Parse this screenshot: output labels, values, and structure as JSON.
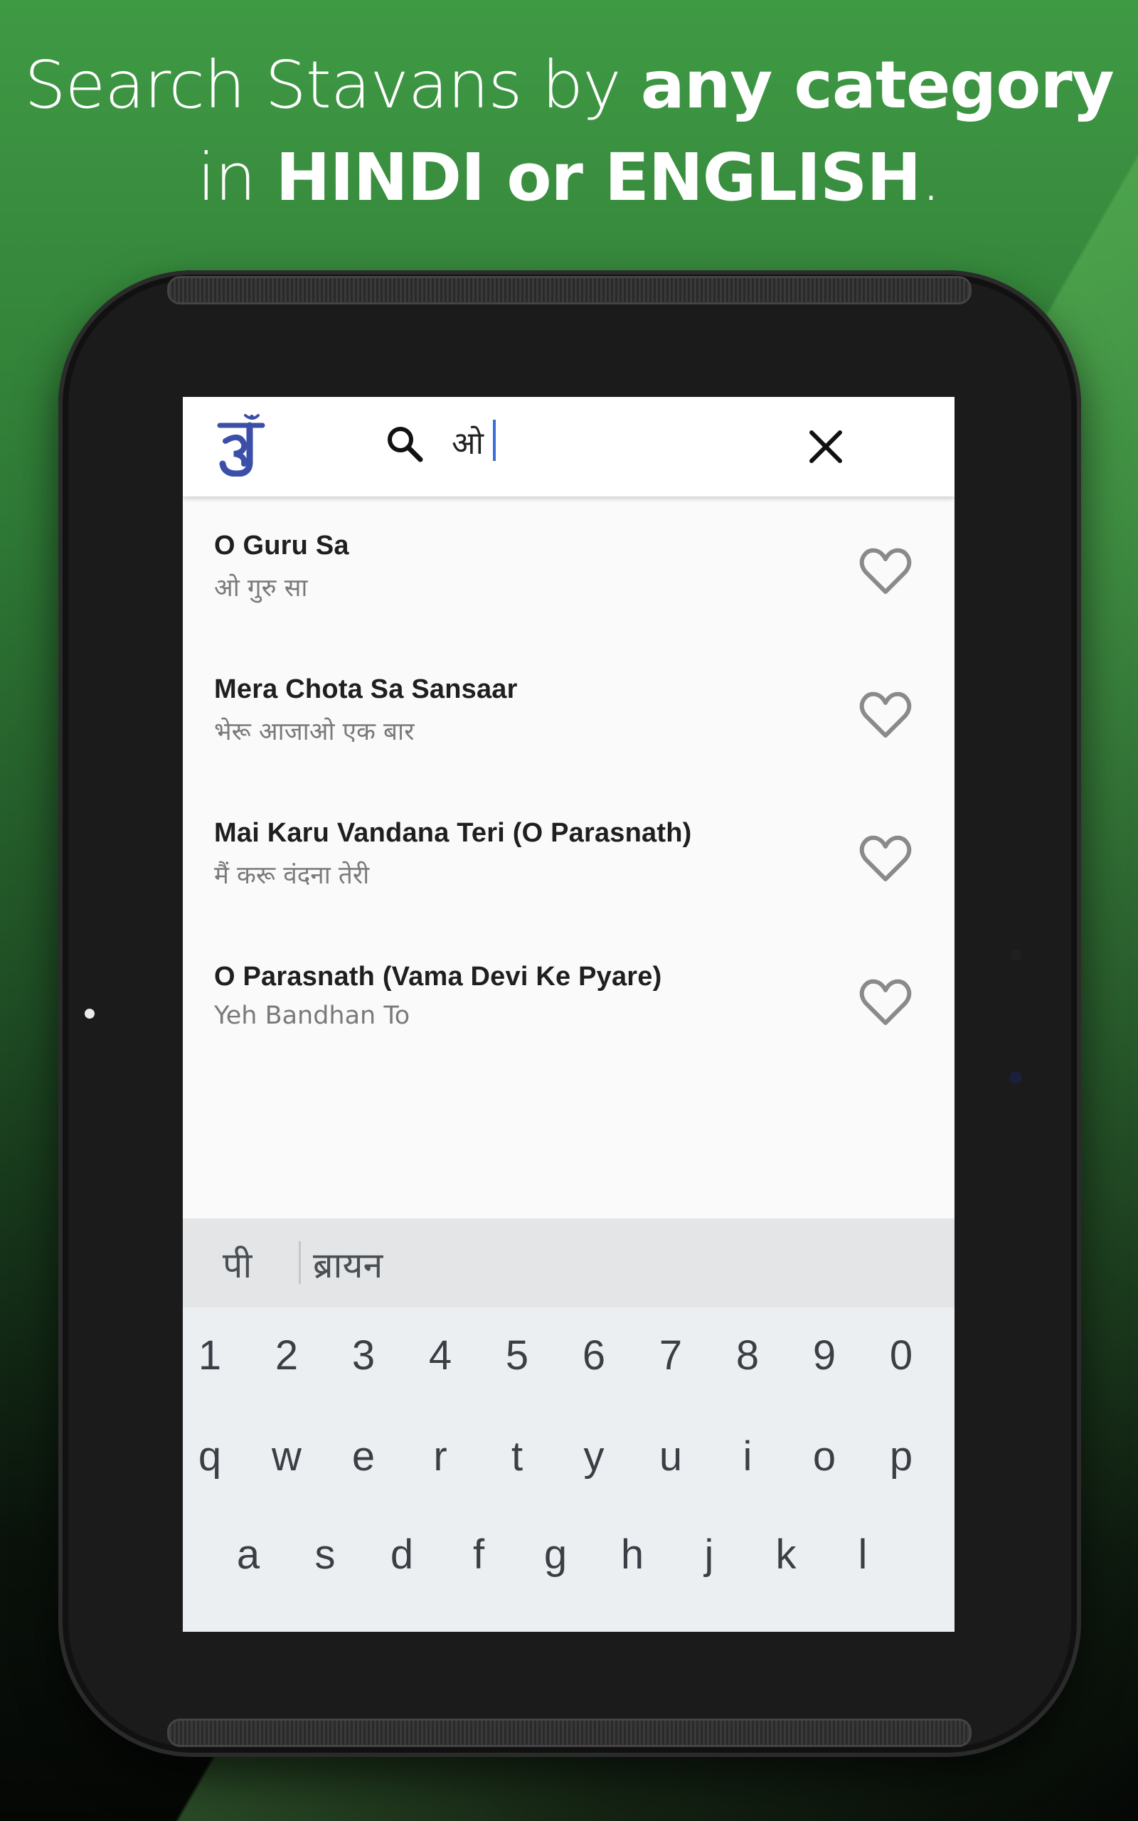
{
  "headline": {
    "line1_light": "Search Stavans by ",
    "line1_bold": "any category",
    "line2_light": "in ",
    "line2_bold1": "HINDI",
    "line2_light2": " or ",
    "line2_bold2": "ENGLISH",
    "line2_end": "."
  },
  "search": {
    "query": "ओ",
    "accent": "#3b6fd8"
  },
  "results": [
    {
      "title": "O Guru Sa",
      "subtitle": "ओ गुरु सा"
    },
    {
      "title": "Mera Chota Sa Sansaar",
      "subtitle": "भेरू आजाओ एक बार"
    },
    {
      "title": "Mai Karu Vandana Teri (O Parasnath)",
      "subtitle": "मैं करू वंदना तेरी"
    },
    {
      "title": "O Parasnath (Vama Devi Ke Pyare)",
      "subtitle": "Yeh Bandhan To"
    }
  ],
  "icons": {
    "logo": "jain-om-logo",
    "search": "search-icon",
    "close": "close-icon",
    "favorite": "heart-outline-icon"
  },
  "keyboard": {
    "suggestions": [
      "पी",
      "ब्रायन"
    ],
    "row_numbers": [
      "1",
      "2",
      "3",
      "4",
      "5",
      "6",
      "7",
      "8",
      "9",
      "0"
    ],
    "row_qwerty": [
      "q",
      "w",
      "e",
      "r",
      "t",
      "y",
      "u",
      "i",
      "o",
      "p"
    ],
    "row_asdf": [
      "a",
      "s",
      "d",
      "f",
      "g",
      "h",
      "j",
      "k",
      "l"
    ]
  },
  "colors": {
    "logo_blue": "#3b4fa8",
    "heart_gray": "#8a8a8a"
  }
}
